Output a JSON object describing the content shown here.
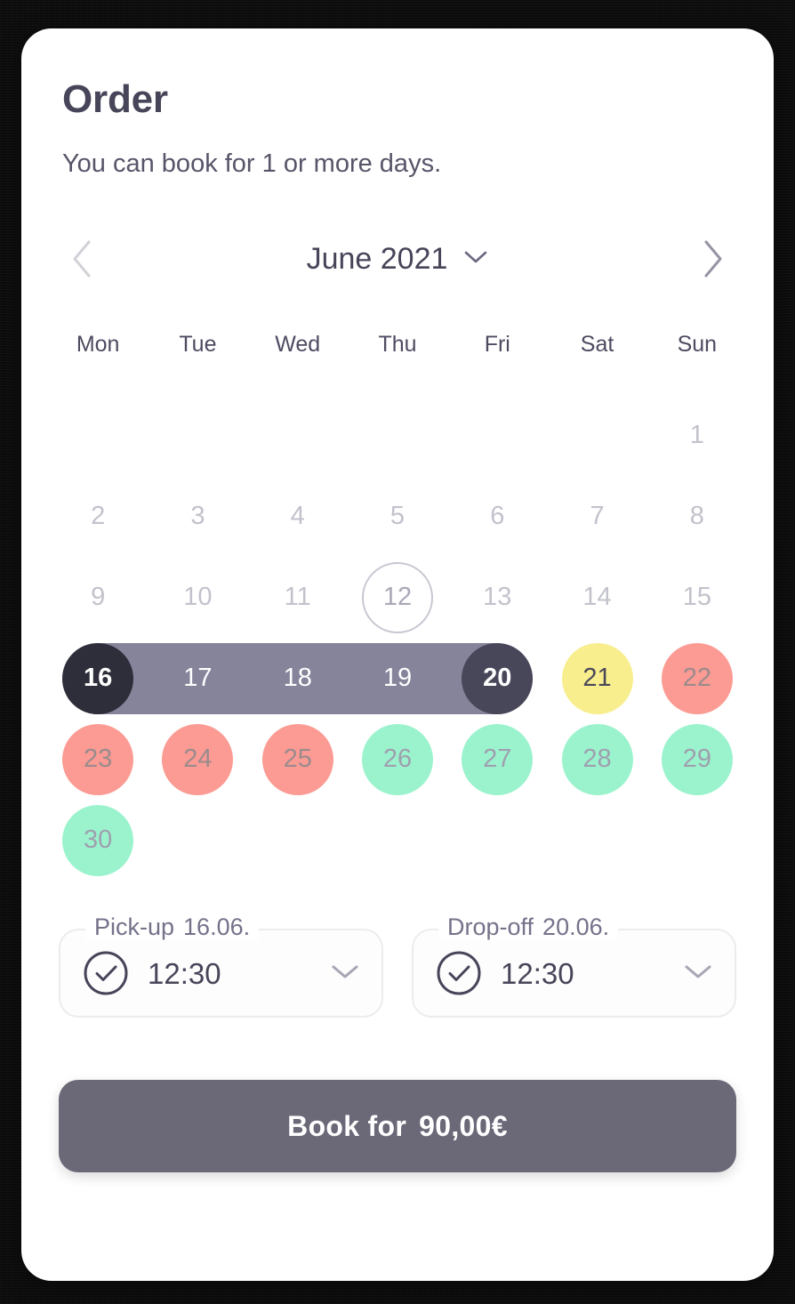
{
  "card": {
    "title": "Order",
    "subtitle": "You can book for 1 or more days."
  },
  "calendar": {
    "prev_icon": "chevron-left-icon",
    "next_icon": "chevron-right-icon",
    "month_label": "June 2021",
    "month_dropdown_icon": "chevron-down-icon",
    "weekdays": [
      "Mon",
      "Tue",
      "Wed",
      "Thu",
      "Fri",
      "Sat",
      "Sun"
    ],
    "weeks": [
      [
        {
          "day": "",
          "state": "empty"
        },
        {
          "day": "",
          "state": "empty"
        },
        {
          "day": "",
          "state": "empty"
        },
        {
          "day": "",
          "state": "empty"
        },
        {
          "day": "",
          "state": "empty"
        },
        {
          "day": "",
          "state": "empty"
        },
        {
          "day": "1",
          "state": "past"
        }
      ],
      [
        {
          "day": "2",
          "state": "past"
        },
        {
          "day": "3",
          "state": "past"
        },
        {
          "day": "4",
          "state": "past"
        },
        {
          "day": "5",
          "state": "past"
        },
        {
          "day": "6",
          "state": "past"
        },
        {
          "day": "7",
          "state": "past"
        },
        {
          "day": "8",
          "state": "past"
        }
      ],
      [
        {
          "day": "9",
          "state": "past"
        },
        {
          "day": "10",
          "state": "past"
        },
        {
          "day": "11",
          "state": "past"
        },
        {
          "day": "12",
          "state": "today"
        },
        {
          "day": "13",
          "state": "past"
        },
        {
          "day": "14",
          "state": "past"
        },
        {
          "day": "15",
          "state": "past"
        }
      ],
      [
        {
          "day": "16",
          "state": "sel-start"
        },
        {
          "day": "17",
          "state": "sel-mid"
        },
        {
          "day": "18",
          "state": "sel-mid"
        },
        {
          "day": "19",
          "state": "sel-mid"
        },
        {
          "day": "20",
          "state": "sel-end"
        },
        {
          "day": "21",
          "state": "avail-partial"
        },
        {
          "day": "22",
          "state": "avail-busy"
        }
      ],
      [
        {
          "day": "23",
          "state": "avail-busy"
        },
        {
          "day": "24",
          "state": "avail-busy"
        },
        {
          "day": "25",
          "state": "avail-busy"
        },
        {
          "day": "26",
          "state": "avail-free"
        },
        {
          "day": "27",
          "state": "avail-free"
        },
        {
          "day": "28",
          "state": "avail-free"
        },
        {
          "day": "29",
          "state": "avail-free"
        }
      ],
      [
        {
          "day": "30",
          "state": "avail-free"
        },
        {
          "day": "",
          "state": "empty"
        },
        {
          "day": "",
          "state": "empty"
        },
        {
          "day": "",
          "state": "empty"
        },
        {
          "day": "",
          "state": "empty"
        },
        {
          "day": "",
          "state": "empty"
        },
        {
          "day": "",
          "state": "empty"
        }
      ]
    ]
  },
  "pickup": {
    "label": "Pick-up",
    "date": "16.06.",
    "time": "12:30",
    "check_icon": "check-circle-icon",
    "dropdown_icon": "chevron-down-icon"
  },
  "dropoff": {
    "label": "Drop-off",
    "date": "20.06.",
    "time": "12:30",
    "check_icon": "check-circle-icon",
    "dropdown_icon": "chevron-down-icon"
  },
  "cta": {
    "label": "Book for",
    "price": "90,00€"
  },
  "colors": {
    "selection_band": "#85849a",
    "selection_start": "#2e2e3a",
    "selection_end": "#484659",
    "available": "#9bf3cd",
    "busy": "#fb9b93",
    "partial": "#f8ee8e",
    "button": "#6b6878",
    "text_dark": "#474559",
    "text_muted": "#c2c2cc"
  }
}
